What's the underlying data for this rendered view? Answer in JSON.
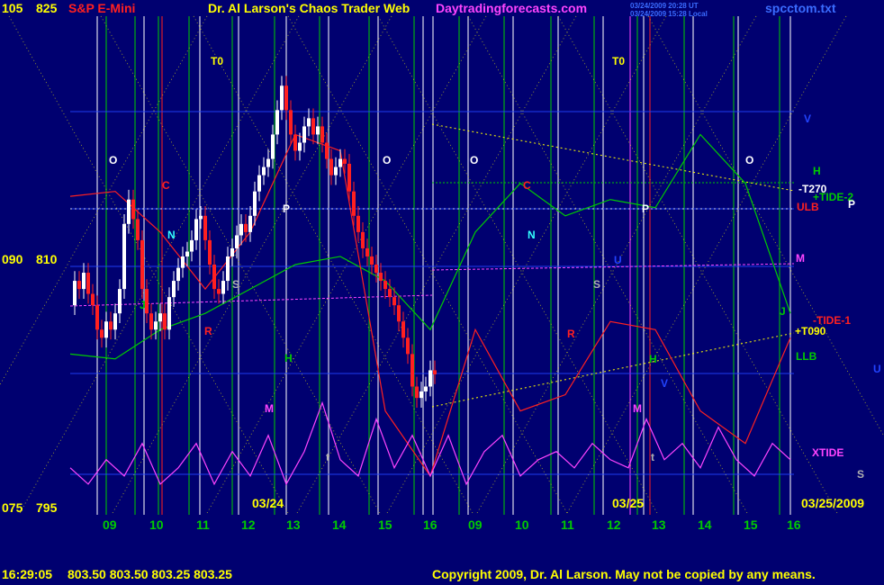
{
  "header": {
    "left_price_top": "105",
    "left_value_top": "825",
    "instrument": "S&P E-Mini",
    "site_title": "Dr. Al Larson's Chaos Trader Web",
    "site_url": "Daytradingforecasts.com",
    "timestamp_ut": "03/24/2009 20:28 UT",
    "timestamp_local": "03/24/2009 15:28 Local",
    "data_file": "spcctom.txt"
  },
  "left_axis": {
    "mid_price": "090",
    "mid_value": "810",
    "bottom_price": "075",
    "bottom_value": "795"
  },
  "date_labels": {
    "day1": "03/24",
    "day2": "03/25",
    "right_date": "03/25/2009"
  },
  "footer": {
    "time": "16:29:05",
    "quotes": "803.50 803.50 803.25 803.25",
    "copyright": "Copyright 2009, Dr. Al Larson. May not be copied by any means."
  },
  "colors": {
    "background": "#000070",
    "white": "#ffffff",
    "yellow": "#ffff00",
    "green": "#00cc00",
    "red": "#ff2020",
    "magenta": "#ff44ff",
    "blue": "#2244ff",
    "cyan": "#33ffff"
  },
  "chart_data": {
    "type": "line",
    "xlabel": "",
    "ylabel": "",
    "ylim": [
      795,
      825
    ],
    "y_ticks": [
      795,
      810,
      825
    ],
    "x_tick_labels": [
      "09",
      "10",
      "11",
      "12",
      "13",
      "14",
      "15",
      "16",
      "09",
      "10",
      "11",
      "12",
      "13",
      "14",
      "15",
      "16"
    ],
    "annotations": {
      "left_side": [
        {
          "text": "T0",
          "color": "yellow"
        },
        {
          "text": "O",
          "color": "white"
        },
        {
          "text": "C",
          "color": "red"
        },
        {
          "text": "N",
          "color": "cyan"
        },
        {
          "text": "P",
          "color": "white"
        },
        {
          "text": "O",
          "color": "white"
        },
        {
          "text": "S",
          "color": "gray"
        },
        {
          "text": "J",
          "color": "green"
        },
        {
          "text": "R",
          "color": "red"
        },
        {
          "text": "H",
          "color": "green"
        },
        {
          "text": "M",
          "color": "magenta"
        },
        {
          "text": "t",
          "color": "gray"
        }
      ],
      "right_side": [
        {
          "text": "T0",
          "color": "yellow"
        },
        {
          "text": "O",
          "color": "white"
        },
        {
          "text": "C",
          "color": "red"
        },
        {
          "text": "N",
          "color": "cyan"
        },
        {
          "text": "P",
          "color": "white"
        },
        {
          "text": "O",
          "color": "white"
        },
        {
          "text": "S",
          "color": "gray"
        },
        {
          "text": "U",
          "color": "blue"
        },
        {
          "text": "R",
          "color": "red"
        },
        {
          "text": "H",
          "color": "green"
        },
        {
          "text": "V",
          "color": "blue"
        },
        {
          "text": "M",
          "color": "magenta"
        },
        {
          "text": "t",
          "color": "gray"
        }
      ],
      "far_right": [
        {
          "text": "V",
          "color": "blue"
        },
        {
          "text": "H",
          "color": "green"
        },
        {
          "text": "-T270",
          "color": "white"
        },
        {
          "text": "+TIDE-2",
          "color": "green"
        },
        {
          "text": "ULB",
          "color": "red"
        },
        {
          "text": "P",
          "color": "white"
        },
        {
          "text": "M",
          "color": "magenta"
        },
        {
          "text": "J",
          "color": "green"
        },
        {
          "text": "-TIDE-1",
          "color": "red"
        },
        {
          "text": "+T090",
          "color": "yellow"
        },
        {
          "text": "LLB",
          "color": "green"
        },
        {
          "text": "U",
          "color": "blue"
        },
        {
          "text": "XTIDE",
          "color": "magenta"
        },
        {
          "text": "S",
          "color": "gray"
        }
      ]
    },
    "series": [
      {
        "style": "candles (white up / red down)",
        "x": [
          0,
          5,
          10,
          15,
          20,
          25,
          30,
          35,
          40,
          45,
          50,
          55,
          60,
          65,
          70,
          75,
          80,
          85,
          90,
          95,
          100,
          105,
          110,
          115,
          120,
          125,
          130,
          135,
          140,
          145,
          150,
          155,
          160,
          165,
          170,
          175,
          180,
          185,
          190,
          195,
          200,
          205,
          210,
          215,
          220,
          225,
          230,
          235,
          240,
          245,
          250,
          255,
          260,
          265,
          270,
          275,
          280,
          285,
          290,
          295,
          300,
          305,
          310,
          315,
          320,
          325,
          330,
          335,
          340,
          345,
          350,
          355,
          360,
          365,
          370,
          375,
          380,
          385,
          390,
          395,
          400,
          405
        ],
        "values": [
          807.5,
          809,
          808.5,
          809.5,
          808.2,
          807.5,
          806,
          805.5,
          806.5,
          806,
          807,
          808.5,
          812.5,
          814,
          812.8,
          811.5,
          808.5,
          807,
          806,
          806.5,
          807,
          806,
          808,
          809,
          809.8,
          810.5,
          810.8,
          811.5,
          812.8,
          813,
          811.5,
          810,
          808.5,
          808.2,
          809,
          810.5,
          811,
          811.8,
          812.5,
          812,
          813,
          814.5,
          815.5,
          816,
          816.5,
          818,
          819.5,
          821,
          819.5,
          818,
          817,
          817.5,
          818.5,
          819,
          818,
          818.5,
          817.5,
          816.5,
          815.5,
          816,
          816.5,
          816.2,
          814.5,
          813,
          812,
          811,
          810.5,
          810,
          809.5,
          809,
          808.5,
          808,
          807.5,
          806.5,
          805.5,
          804.5,
          802.5,
          801.8,
          802.2,
          802.5,
          803.5,
          803.25
        ]
      },
      {
        "name": "LLB",
        "style": "green line",
        "x": [
          0,
          50,
          100,
          150,
          200,
          250,
          300,
          350,
          400,
          450,
          500,
          550,
          600,
          650,
          700,
          750,
          800
        ],
        "values": [
          804.5,
          804.2,
          806,
          807,
          808.5,
          810,
          810.5,
          809,
          806,
          812,
          815,
          813,
          814,
          813.5,
          818,
          815,
          807
        ]
      },
      {
        "name": "ULB",
        "style": "red line",
        "x": [
          0,
          50,
          100,
          150,
          200,
          250,
          300,
          350,
          400,
          450,
          500,
          550,
          600,
          650,
          700,
          750,
          800
        ],
        "values": [
          814.2,
          814.5,
          812,
          808.5,
          812,
          818,
          817,
          801,
          797,
          806,
          801,
          802,
          806.5,
          806,
          801,
          799,
          805.5
        ]
      },
      {
        "name": "XTIDE",
        "style": "magenta oscillator",
        "x": [
          0,
          20,
          40,
          60,
          80,
          100,
          120,
          140,
          160,
          180,
          200,
          220,
          240,
          260,
          280,
          300,
          320,
          340,
          360,
          380,
          400,
          420,
          440,
          460,
          480,
          500,
          520,
          540,
          560,
          580,
          600,
          620,
          640,
          660,
          680,
          700,
          720,
          740,
          760,
          780,
          800
        ],
        "values": [
          797.5,
          796.5,
          798,
          797,
          799,
          796.5,
          797.5,
          799,
          796.5,
          798.5,
          797,
          799.5,
          796.5,
          798.5,
          801.5,
          798,
          797,
          800.5,
          797.5,
          799.5,
          797,
          799.5,
          796.5,
          798.5,
          799.5,
          797,
          798,
          798.5,
          797.5,
          799,
          798,
          797.5,
          800.5,
          798,
          799,
          797.5,
          800,
          798,
          797,
          799,
          798
        ]
      }
    ]
  }
}
